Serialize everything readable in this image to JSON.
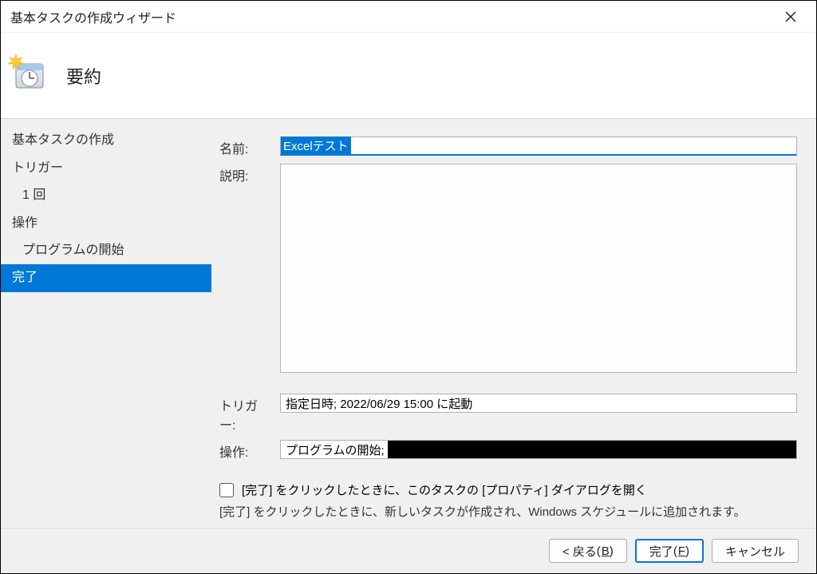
{
  "window": {
    "title": "基本タスクの作成ウィザード"
  },
  "header": {
    "page_title": "要約"
  },
  "sidebar": {
    "items": [
      {
        "label": "基本タスクの作成",
        "sub": false
      },
      {
        "label": "トリガー",
        "sub": false
      },
      {
        "label": "1 回",
        "sub": true
      },
      {
        "label": "操作",
        "sub": false
      },
      {
        "label": "プログラムの開始",
        "sub": true
      },
      {
        "label": "完了",
        "sub": false,
        "selected": true
      }
    ]
  },
  "form": {
    "name_label": "名前:",
    "name_value": "Excelテスト",
    "desc_label": "説明:",
    "trigger_label": "トリガー:",
    "trigger_value": "指定日時; 2022/06/29 15:00 に起動",
    "action_label": "操作:",
    "action_value": "プログラムの開始;",
    "checkbox_label": "[完了] をクリックしたときに、このタスクの [プロパティ] ダイアログを開く",
    "hint": "[完了] をクリックしたときに、新しいタスクが作成され、Windows スケジュールに追加されます。"
  },
  "footer": {
    "back": "< 戻る",
    "back_mn": "B",
    "finish": "完了",
    "finish_mn": "F",
    "cancel": "キャンセル"
  }
}
